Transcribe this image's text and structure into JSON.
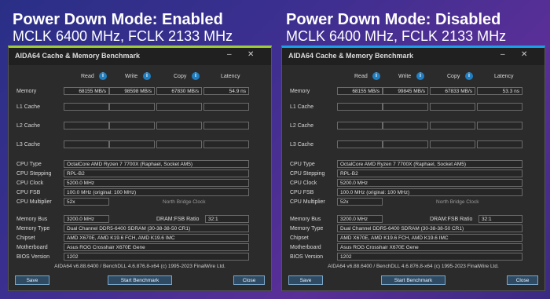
{
  "panels": [
    {
      "headline": "Power Down Mode: Enabled",
      "subline": "MCLK 6400 MHz, FCLK 2133 MHz",
      "window_title": "AIDA64 Cache & Memory Benchmark",
      "controls": {
        "minimize": "–",
        "close": "✕"
      },
      "columns": {
        "read": "Read",
        "write": "Write",
        "copy": "Copy",
        "latency": "Latency"
      },
      "memory": {
        "label": "Memory",
        "read": "68155 MB/s",
        "write": "98598 MB/s",
        "copy": "67830 MB/s",
        "latency": "54.9 ns"
      },
      "cache": {
        "l1": "L1 Cache",
        "l2": "L2 Cache",
        "l3": "L3 Cache"
      },
      "cpu": {
        "type_label": "CPU Type",
        "type": "OctalCore AMD Ryzen 7 7700X (Raphael, Socket AM5)",
        "stepping_label": "CPU Stepping",
        "stepping": "RPL-B2",
        "clock_label": "CPU Clock",
        "clock": "5200.0 MHz",
        "fsb_label": "CPU FSB",
        "fsb": "100.0 MHz (original: 100 MHz)",
        "mult_label": "CPU Multiplier",
        "mult": "52x",
        "nbc": "North Bridge Clock"
      },
      "mem": {
        "bus_label": "Memory Bus",
        "bus": "3200.0 MHz",
        "ratio_label": "DRAM:FSB Ratio",
        "ratio": "32:1",
        "type_label": "Memory Type",
        "type": "Dual Channel DDR5-6400 SDRAM (30-38-38-50 CR1)",
        "chipset_label": "Chipset",
        "chipset": "AMD X670E, AMD K19.6 FCH, AMD K19.6 IMC",
        "mobo_label": "Motherboard",
        "mobo": "Asus ROG Crosshair X670E Gene",
        "bios_label": "BIOS Version",
        "bios": "1202"
      },
      "footer": "AIDA64 v6.88.6400 / BenchDLL 4.6.876.8-x64  (c) 1995-2023 FinalWire Ltd.",
      "buttons": {
        "save": "Save",
        "start": "Start Benchmark",
        "close": "Close"
      }
    },
    {
      "headline": "Power Down Mode: Disabled",
      "subline": "MCLK 6400 MHz, FCLK 2133 MHz",
      "window_title": "AIDA64 Cache & Memory Benchmark",
      "controls": {
        "minimize": "–",
        "close": "✕"
      },
      "columns": {
        "read": "Read",
        "write": "Write",
        "copy": "Copy",
        "latency": "Latency"
      },
      "memory": {
        "label": "Memory",
        "read": "68155 MB/s",
        "write": "99845 MB/s",
        "copy": "67833 MB/s",
        "latency": "53.3 ns"
      },
      "cache": {
        "l1": "L1 Cache",
        "l2": "L2 Cache",
        "l3": "L3 Cache"
      },
      "cpu": {
        "type_label": "CPU Type",
        "type": "OctalCore AMD Ryzen 7 7700X (Raphael, Socket AM5)",
        "stepping_label": "CPU Stepping",
        "stepping": "RPL-B2",
        "clock_label": "CPU Clock",
        "clock": "5200.0 MHz",
        "fsb_label": "CPU FSB",
        "fsb": "100.0 MHz (original: 100 MHz)",
        "mult_label": "CPU Multiplier",
        "mult": "52x",
        "nbc": "North Bridge Clock"
      },
      "mem": {
        "bus_label": "Memory Bus",
        "bus": "3200.0 MHz",
        "ratio_label": "DRAM:FSB Ratio",
        "ratio": "32:1",
        "type_label": "Memory Type",
        "type": "Dual Channel DDR5-6400 SDRAM (30-38-38-50 CR1)",
        "chipset_label": "Chipset",
        "chipset": "AMD X670E, AMD K19.6 FCH, AMD K19.6 IMC",
        "mobo_label": "Motherboard",
        "mobo": "Asus ROG Crosshair X670E Gene",
        "bios_label": "BIOS Version",
        "bios": "1202"
      },
      "footer": "AIDA64 v6.88.6400 / BenchDLL 4.6.876.8-x64  (c) 1995-2023 FinalWire Ltd.",
      "buttons": {
        "save": "Save",
        "start": "Start Benchmark",
        "close": "Close"
      }
    }
  ],
  "colors": {
    "accent_left": "#9ecb3a",
    "accent_right": "#1aa0e6",
    "info": "#1f7fc2"
  },
  "icons": {
    "info": "info-icon"
  }
}
